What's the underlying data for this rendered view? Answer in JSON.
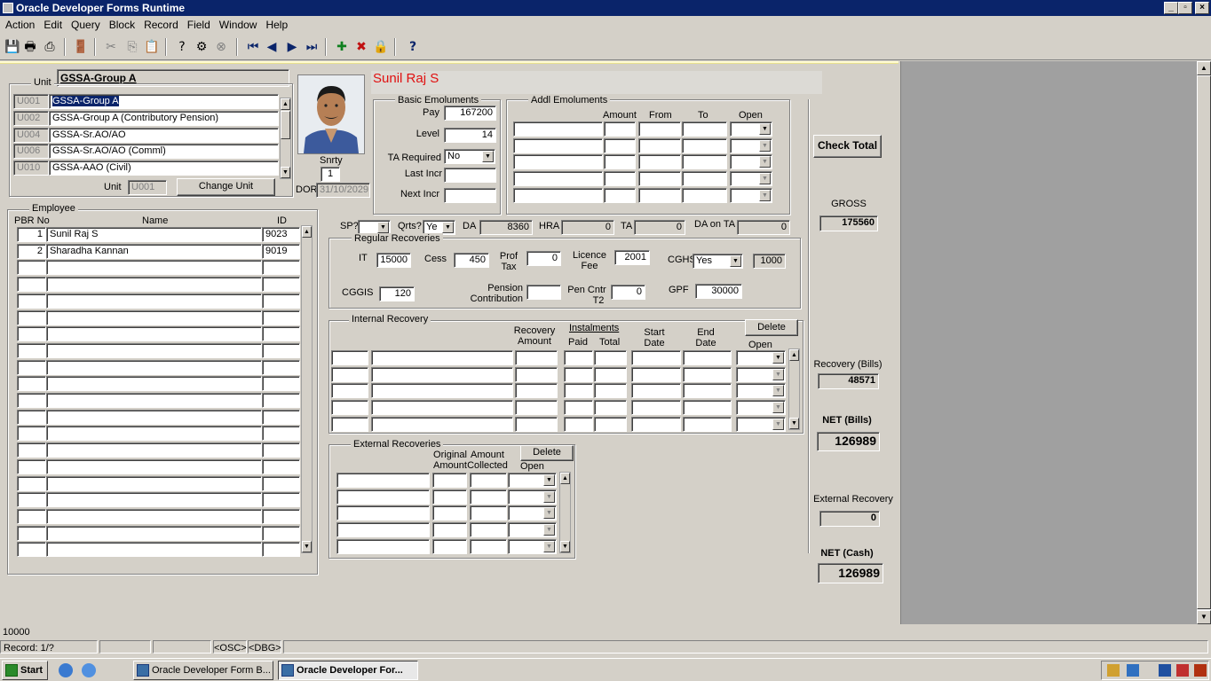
{
  "window": {
    "title": "Oracle Developer Forms Runtime",
    "min": "_",
    "max": "▫",
    "close": "×"
  },
  "menu": [
    "Action",
    "Edit",
    "Query",
    "Block",
    "Record",
    "Field",
    "Window",
    "Help"
  ],
  "toolbar": {
    "icons": [
      "save-icon",
      "print-icon",
      "print-setup-icon",
      "exit-icon",
      "cut-icon",
      "copy-icon",
      "paste-icon",
      "enter-query-icon",
      "execute-query-icon",
      "cancel-query-icon",
      "first-record-icon",
      "previous-record-icon",
      "next-record-icon",
      "last-record-icon",
      "insert-record-icon",
      "delete-record-icon",
      "lock-record-icon",
      "help-icon"
    ],
    "glyphs": [
      "💾",
      "🖶",
      "⎙",
      "🚪",
      "✂",
      "⎘",
      "📋",
      "?",
      "⚙",
      "⊗",
      "⏮",
      "◀",
      "▶",
      "⏭",
      "✚",
      "✖",
      "🔒",
      "?"
    ]
  },
  "unit_block": {
    "header": "GSSA-Group A",
    "title": "Unit",
    "rows": [
      {
        "code": "U001",
        "name": "GSSA-Group A"
      },
      {
        "code": "U002",
        "name": "GSSA-Group A (Contributory Pension)"
      },
      {
        "code": "U004",
        "name": "GSSA-Sr.AO/AO"
      },
      {
        "code": "U006",
        "name": "GSSA-Sr.AO/AO (Comml)"
      },
      {
        "code": "U010",
        "name": "GSSA-AAO (Civil)"
      }
    ],
    "unit_label": "Unit",
    "unit_value": "U001",
    "change_unit": "Change Unit"
  },
  "photo": {
    "snrty_label": "Snrty",
    "snrty_value": "1",
    "dor_label": "DOR",
    "dor_value": "31/10/2029"
  },
  "employee_name": "Sunil Raj S",
  "employee": {
    "title": "Employee",
    "col_pbr": "PBR No",
    "col_name": "Name",
    "col_id": "ID",
    "rows": [
      {
        "pbr": "1",
        "name": "Sunil Raj S",
        "id": "9023"
      },
      {
        "pbr": "2",
        "name": "Sharadha Kannan",
        "id": "9019"
      }
    ],
    "empty_rows": 18
  },
  "basic": {
    "title": "Basic Emoluments",
    "pay_label": "Pay",
    "pay": "167200",
    "level_label": "Level",
    "level": "14",
    "ta_req_label": "TA Required",
    "ta_req": "No",
    "last_incr_label": "Last Incr",
    "next_incr_label": "Next Incr"
  },
  "addl": {
    "title": "Addl Emoluments",
    "col_amount": "Amount",
    "col_from": "From",
    "col_to": "To",
    "col_open": "Open"
  },
  "allowances": {
    "sp_label": "SP?",
    "qrts_label": "Qrts?",
    "qrts_value": "Ye",
    "da_label": "DA",
    "da": "8360",
    "hra_label": "HRA",
    "hra": "0",
    "ta_label": "TA",
    "ta": "0",
    "da_on_ta_label": "DA on TA",
    "da_on_ta": "0"
  },
  "regular": {
    "title": "Regular Recoveries",
    "it_label": "IT",
    "it": "15000",
    "cess_label": "Cess",
    "cess": "450",
    "prof_tax_label1": "Prof",
    "prof_tax_label2": "Tax",
    "prof_tax": "0",
    "licence_label1": "Licence",
    "licence_label2": "Fee",
    "licence": "2001",
    "cghs_label": "CGHS",
    "cghs": "Yes",
    "cghs_amt": "1000",
    "cggis_label": "CGGIS",
    "cggis": "120",
    "pension_label1": "Pension",
    "pension_label2": "Contribution",
    "pen_cntr_label1": "Pen Cntr",
    "pen_cntr_label2": "T2",
    "pen_cntr": "0",
    "gpf_label": "GPF",
    "gpf": "30000"
  },
  "internal": {
    "title": "Internal Recovery",
    "col_recovery1": "Recovery",
    "col_recovery2": "Amount",
    "instalments": "Instalments",
    "col_paid": "Paid",
    "col_total": "Total",
    "col_start1": "Start",
    "col_start2": "Date",
    "col_end1": "End",
    "col_end2": "Date",
    "col_open": "Open",
    "delete": "Delete"
  },
  "external": {
    "title": "External Recoveries",
    "col_orig1": "Original",
    "col_orig2": "Amount",
    "col_coll1": "Amount",
    "col_coll2": "Collected",
    "col_open": "Open",
    "delete": "Delete"
  },
  "totals": {
    "check_total": "Check Total",
    "gross_label": "GROSS",
    "gross": "175560",
    "recovery_bills_label": "Recovery (Bills)",
    "recovery_bills": "48571",
    "net_bills_label": "NET (Bills)",
    "net_bills": "126989",
    "external_recovery_label": "External Recovery",
    "external_recovery": "0",
    "net_cash_label": "NET (Cash)",
    "net_cash": "126989"
  },
  "status": {
    "message": "10000",
    "record": "Record: 1/?",
    "osc": "<OSC>",
    "dbg": "<DBG>"
  },
  "taskbar": {
    "start": "Start",
    "items": [
      "Oracle Developer Form B...",
      "Oracle Developer For..."
    ]
  }
}
